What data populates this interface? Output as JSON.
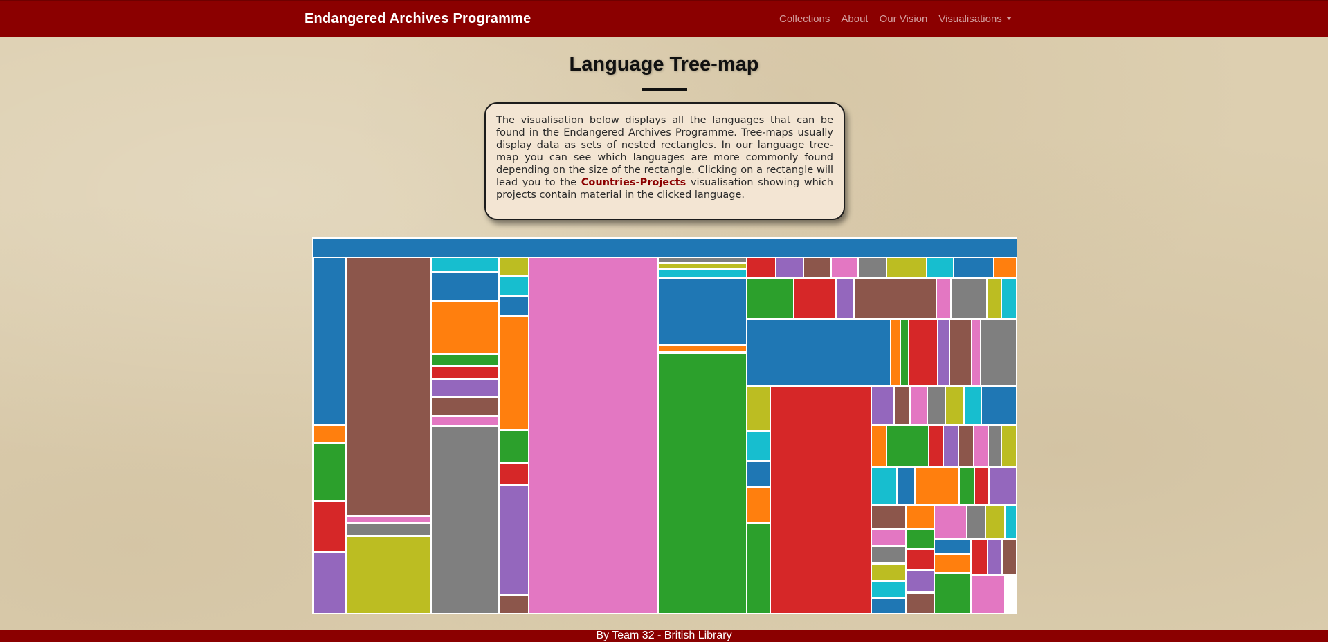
{
  "nav": {
    "brand": "Endangered Archives Programme",
    "links": [
      "Collections",
      "About",
      "Our Vision",
      "Visualisations"
    ]
  },
  "page": {
    "title": "Language Tree-map",
    "description_before": "The visualisation below displays all the languages that can be found in the Endangered Archives Programme. Tree-maps usually display data as sets of nested rectangles. In our language tree-map you can see which languages are more commonly found depending on the size of the rectangle. Clicking on a rectangle will lead you to the ",
    "description_link": "Countries-Projects",
    "description_after": " visualisation showing which projects contain material in the clicked language."
  },
  "footer": {
    "text": "By Team 32 - British Library"
  },
  "colors": {
    "brand": "#8b0000",
    "palette": [
      "#1f77b4",
      "#ff7f0e",
      "#2ca02c",
      "#d62728",
      "#9467bd",
      "#8c564b",
      "#e377c2",
      "#7f7f7f",
      "#bcbd22",
      "#17becf"
    ]
  }
}
